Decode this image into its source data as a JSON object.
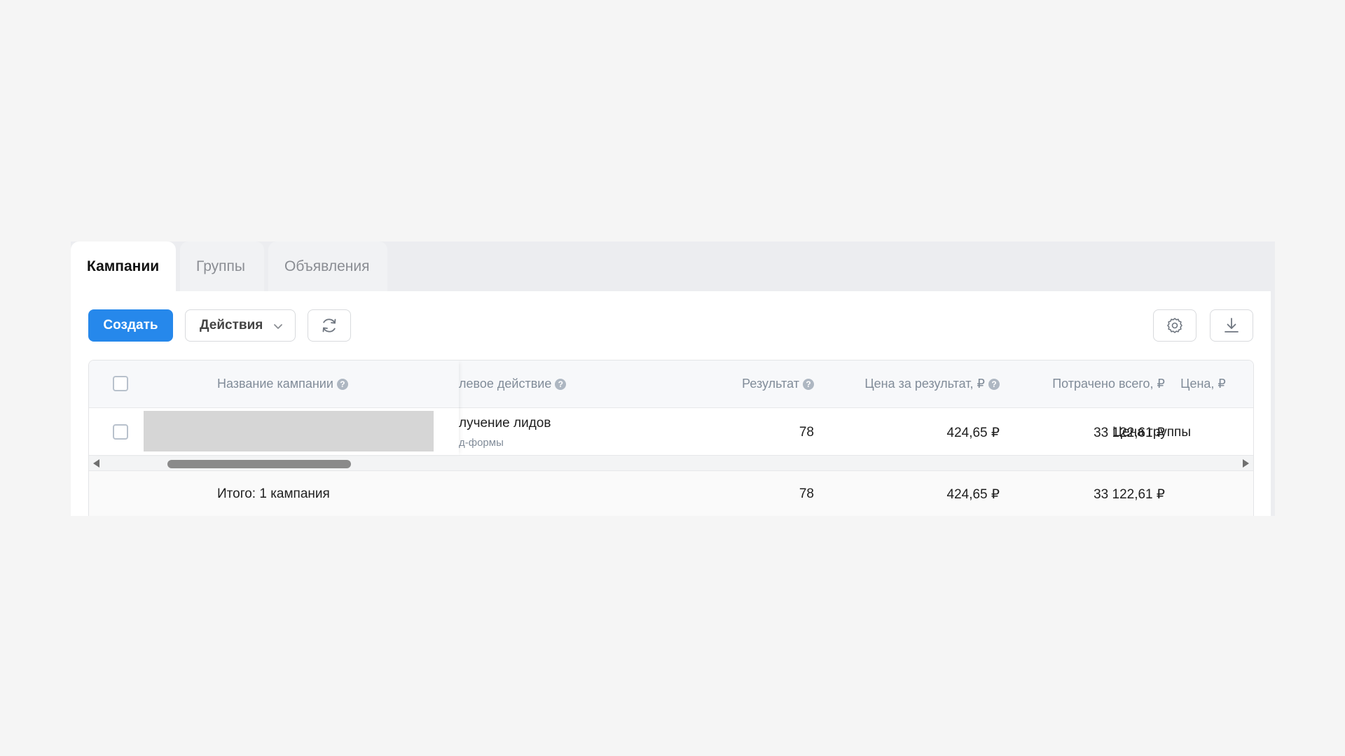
{
  "tabs": [
    {
      "label": "Кампании",
      "active": true
    },
    {
      "label": "Группы",
      "active": false
    },
    {
      "label": "Объявления",
      "active": false
    }
  ],
  "toolbar": {
    "create_label": "Создать",
    "actions_label": "Действия",
    "icons": [
      "refresh-icon",
      "gear-icon",
      "download-icon"
    ]
  },
  "table": {
    "columns": {
      "name": "Название кампании",
      "goal": "левое действие",
      "result": "Результат",
      "price_per_result": "Цена за результат, ₽",
      "spent_total": "Потрачено всего, ₽",
      "price": "Цена, ₽"
    },
    "rows": [
      {
        "goal_title": "лучение лидов",
        "goal_sub": "д-формы",
        "result": "78",
        "price_per_result": "424,65 ₽",
        "spent_total": "33 122,61 ₽",
        "price": "Цена группы"
      }
    ],
    "totals": {
      "label": "Итого: 1 кампания",
      "result": "78",
      "price_per_result": "424,65 ₽",
      "spent_total": "33 122,61 ₽"
    }
  },
  "colors": {
    "accent": "#2688eb",
    "background": "#f5f5f5",
    "header_text": "#818c99"
  }
}
